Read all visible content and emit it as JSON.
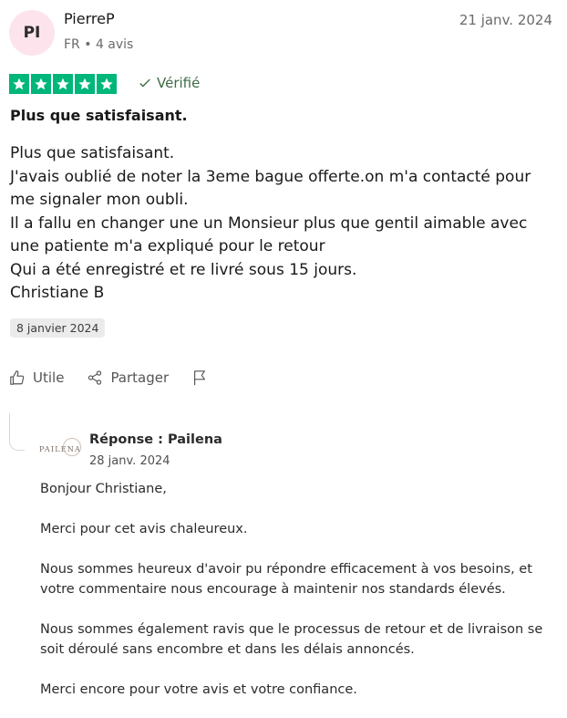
{
  "review": {
    "avatar_initials": "PI",
    "author": "PierreP",
    "meta": "FR • 4 avis",
    "date": "21 janv. 2024",
    "rating": 5,
    "verified_label": "Vérifié",
    "title": "Plus que satisfaisant.",
    "body_lines": [
      "Plus que satisfaisant.",
      "J'avais oublié de noter la 3eme bague offerte.on m'a contacté pour me signaler mon oubli.",
      "Il a fallu en changer une un Monsieur plus que gentil aimable avec une patiente m'a expliqué pour le retour",
      "Qui a été enregistré et re livré sous 15 jours.",
      "Christiane B"
    ],
    "experience_date": "8 janvier 2024"
  },
  "actions": {
    "useful_label": "Utile",
    "share_label": "Partager"
  },
  "reply": {
    "logo_text": "PAILENA",
    "title": "Réponse : Pailena",
    "date": "28 janv. 2024",
    "paragraphs": [
      "Bonjour Christiane,",
      "Merci pour cet avis chaleureux.",
      "Nous sommes heureux d'avoir pu répondre efficacement à vos besoins, et votre commentaire nous encourage à maintenir nos standards élevés.",
      "Nous sommes également ravis que le processus de retour et de livraison se soit déroulé sans encombre et dans les délais annoncés.",
      "Merci encore pour votre avis et votre confiance."
    ]
  },
  "colors": {
    "star_green": "#00b67a",
    "verified_green": "#3c6b43",
    "avatar_bg": "#fde4ec"
  }
}
